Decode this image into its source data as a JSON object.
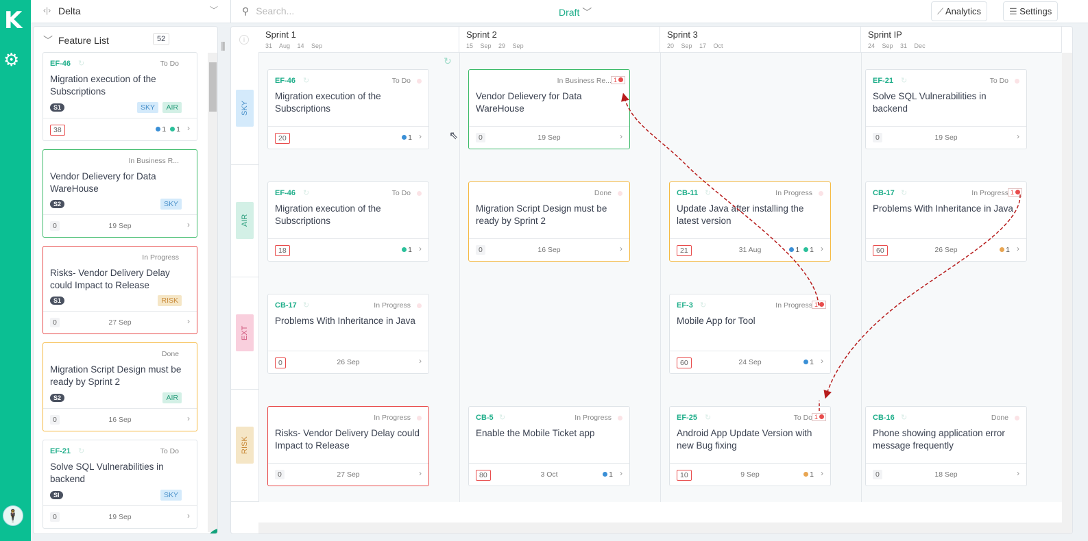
{
  "app": {
    "logo": "K",
    "project": "Delta",
    "search_placeholder": "Search...",
    "mode": "Draft",
    "analytics": "Analytics",
    "settings": "Settings"
  },
  "colors": {
    "brand": "#0bbf93",
    "id": "#1fae8a",
    "green_border": "#3dbb6a",
    "orange_border": "#f5b942",
    "red_border": "#e84c4c"
  },
  "sidebar": {
    "title": "Feature List",
    "count": "52",
    "cards": [
      {
        "id": "EF-46",
        "status": "To Do",
        "title": "Migration execution of the Subscriptions",
        "sprint": "S1",
        "tags": [
          "SKY",
          "AIR"
        ],
        "points": "38",
        "points_flag": true,
        "date": "",
        "dots": [
          {
            "color": "#3a8fd6",
            "count": "1"
          },
          {
            "color": "#2bc09a",
            "count": "1"
          }
        ],
        "border": ""
      },
      {
        "id": "",
        "status": "In Business R...",
        "title": "Vendor Delievery for Data WareHouse",
        "sprint": "S2",
        "tags": [
          "SKY"
        ],
        "points": "0",
        "points_flag": false,
        "date": "19 Sep",
        "dots": [],
        "border": "#3dbb6a"
      },
      {
        "id": "",
        "status": "In Progress",
        "title": "Risks- Vendor Delivery Delay could Impact to Release",
        "sprint": "S1",
        "tags": [
          "RISK"
        ],
        "points": "0",
        "points_flag": false,
        "date": "27 Sep",
        "dots": [],
        "border": "#e84c4c"
      },
      {
        "id": "",
        "status": "Done",
        "title": "Migration Script Design must be ready by Sprint 2",
        "sprint": "S2",
        "tags": [
          "AIR"
        ],
        "points": "0",
        "points_flag": false,
        "date": "16 Sep",
        "dots": [],
        "border": "#f5b942"
      },
      {
        "id": "EF-21",
        "status": "To Do",
        "title": "Solve SQL Vulnerabilities in backend",
        "sprint": "SI",
        "tags": [
          "SKY"
        ],
        "points": "0",
        "points_flag": false,
        "date": "19 Sep",
        "dots": [],
        "border": ""
      }
    ]
  },
  "tag_colors": {
    "SKY": {
      "bg": "#d4eafb",
      "fg": "#4a90c9"
    },
    "AIR": {
      "bg": "#d3f0e6",
      "fg": "#2a9d7c"
    },
    "EXT": {
      "bg": "#f9cfdd",
      "fg": "#d0587d"
    },
    "RISK": {
      "bg": "#f5e6c6",
      "fg": "#c98a3a"
    }
  },
  "sprints": [
    {
      "name": "Sprint 1",
      "start": "31 Aug",
      "end": "14 Sep"
    },
    {
      "name": "Sprint 2",
      "start": "15 Sep",
      "end": "29 Sep"
    },
    {
      "name": "Sprint 3",
      "start": "20 Sep",
      "end": "17 Oct"
    },
    {
      "name": "Sprint IP",
      "start": "24 Sep",
      "end": "31 Dec"
    }
  ],
  "lanes": [
    "SKY",
    "AIR",
    "EXT",
    "RISK"
  ],
  "board_cards": [
    {
      "lane": 0,
      "sprint": 0,
      "id": "EF-46",
      "status": "To Do",
      "title": "Migration execution of the Subscriptions",
      "points": "20",
      "points_flag": true,
      "date": "",
      "dots": [
        {
          "color": "#3a8fd6",
          "count": "1"
        }
      ],
      "border": "",
      "dep": ""
    },
    {
      "lane": 0,
      "sprint": 1,
      "id": "",
      "status": "In Business Re...",
      "title": "Vendor Delievery for Data WareHouse",
      "points": "0",
      "points_flag": false,
      "date": "19 Sep",
      "dots": [],
      "border": "#3dbb6a",
      "dep": "1"
    },
    {
      "lane": 0,
      "sprint": 3,
      "id": "EF-21",
      "status": "To Do",
      "title": "Solve SQL Vulnerabilities in backend",
      "points": "0",
      "points_flag": false,
      "date": "19 Sep",
      "dots": [],
      "border": "",
      "dep": ""
    },
    {
      "lane": 1,
      "sprint": 0,
      "id": "EF-46",
      "status": "To Do",
      "title": "Migration execution of the Subscriptions",
      "points": "18",
      "points_flag": true,
      "date": "",
      "dots": [
        {
          "color": "#2bc09a",
          "count": "1"
        }
      ],
      "border": "",
      "dep": ""
    },
    {
      "lane": 1,
      "sprint": 1,
      "id": "",
      "status": "Done",
      "title": "Migration Script Design must be ready by Sprint 2",
      "points": "0",
      "points_flag": false,
      "date": "16 Sep",
      "dots": [],
      "border": "#f5b942",
      "dep": ""
    },
    {
      "lane": 1,
      "sprint": 2,
      "id": "CB-11",
      "status": "In Progress",
      "title": "Update Java after installing the latest version",
      "points": "21",
      "points_flag": true,
      "date": "31 Aug",
      "dots": [
        {
          "color": "#3a8fd6",
          "count": "1"
        },
        {
          "color": "#2bc09a",
          "count": "1"
        }
      ],
      "border": "#f5b942",
      "dep": ""
    },
    {
      "lane": 1,
      "sprint": 3,
      "id": "CB-17",
      "status": "In Progress",
      "title": "Problems With Inheritance in Java",
      "points": "60",
      "points_flag": true,
      "date": "26 Sep",
      "dots": [
        {
          "color": "#e8a552",
          "count": "1"
        }
      ],
      "border": "",
      "dep": "1"
    },
    {
      "lane": 2,
      "sprint": 0,
      "id": "CB-17",
      "status": "In Progress",
      "title": "Problems With Inheritance in Java",
      "points": "0",
      "points_flag": true,
      "date": "26 Sep",
      "dots": [],
      "border": "",
      "dep": ""
    },
    {
      "lane": 2,
      "sprint": 2,
      "id": "EF-3",
      "status": "In Progress",
      "title": "Mobile App for Tool",
      "points": "60",
      "points_flag": true,
      "date": "24 Sep",
      "dots": [
        {
          "color": "#3a8fd6",
          "count": "1"
        }
      ],
      "border": "",
      "dep": "1"
    },
    {
      "lane": 3,
      "sprint": 0,
      "id": "",
      "status": "In Progress",
      "title": "Risks- Vendor Delivery Delay could Impact to Release",
      "points": "0",
      "points_flag": false,
      "date": "27 Sep",
      "dots": [],
      "border": "#e84c4c",
      "dep": ""
    },
    {
      "lane": 3,
      "sprint": 1,
      "id": "CB-5",
      "status": "In Progress",
      "title": "Enable the Mobile Ticket app",
      "points": "80",
      "points_flag": true,
      "date": "3 Oct",
      "dots": [
        {
          "color": "#3a8fd6",
          "count": "1"
        }
      ],
      "border": "",
      "dep": ""
    },
    {
      "lane": 3,
      "sprint": 2,
      "id": "EF-25",
      "status": "To Do",
      "title": "Android App Update Version with new Bug fixing",
      "points": "10",
      "points_flag": true,
      "date": "9 Sep",
      "dots": [
        {
          "color": "#e8a552",
          "count": "1"
        }
      ],
      "border": "",
      "dep": "1"
    },
    {
      "lane": 3,
      "sprint": 3,
      "id": "CB-16",
      "status": "Done",
      "title": "Phone showing application error message frequently",
      "points": "0",
      "points_flag": false,
      "date": "18 Sep",
      "dots": [],
      "border": "",
      "dep": ""
    }
  ]
}
